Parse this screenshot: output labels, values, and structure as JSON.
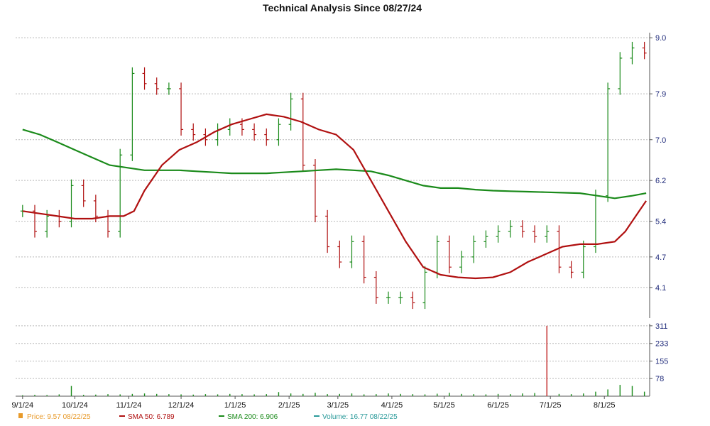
{
  "chart_data": {
    "type": "line",
    "title": "Technical Analysis Since 08/27/24",
    "price_panel": {
      "ylim": [
        3.5,
        9.1
      ],
      "y_ticks": [
        "9.0",
        "7.9",
        "7.0",
        "6.2",
        "5.4",
        "4.7",
        "4.1"
      ],
      "y_tick_values": [
        9.0,
        7.9,
        7.0,
        6.2,
        5.4,
        4.7,
        4.1
      ],
      "grid": true
    },
    "volume_panel": {
      "ylim": [
        0,
        320
      ],
      "y_ticks": [
        "311",
        "233",
        "155",
        "78"
      ],
      "y_tick_values": [
        311,
        233,
        155,
        78
      ],
      "grid": true
    },
    "x_ticks": [
      "9/1/24",
      "10/1/24",
      "11/1/24",
      "12/1/24",
      "1/1/25",
      "2/1/25",
      "3/1/25",
      "4/1/25",
      "5/1/25",
      "6/1/25",
      "7/1/25",
      "8/1/25"
    ],
    "x_tick_days": [
      0,
      30,
      61,
      91,
      122,
      153,
      181,
      212,
      242,
      273,
      303,
      334
    ],
    "x_range_days": [
      -4,
      360
    ],
    "price": {
      "name": "Price",
      "color": "#1a8a1a",
      "down_color": "#b01010",
      "x_days": [
        0,
        7,
        14,
        21,
        28,
        35,
        42,
        49,
        56,
        63,
        70,
        77,
        84,
        91,
        98,
        105,
        112,
        119,
        126,
        133,
        140,
        147,
        154,
        161,
        168,
        175,
        182,
        189,
        196,
        203,
        210,
        217,
        224,
        231,
        238,
        245,
        252,
        259,
        266,
        273,
        280,
        287,
        294,
        301,
        308,
        315,
        322,
        329,
        336,
        343,
        350,
        357
      ],
      "close": [
        5.6,
        5.2,
        5.5,
        5.4,
        6.1,
        5.8,
        5.5,
        5.2,
        6.7,
        8.3,
        8.1,
        8.0,
        8.0,
        7.2,
        7.1,
        7.0,
        7.2,
        7.3,
        7.2,
        7.1,
        7.0,
        7.3,
        7.8,
        6.5,
        5.5,
        4.9,
        4.6,
        5.0,
        4.3,
        3.9,
        3.9,
        3.9,
        3.8,
        4.4,
        5.0,
        4.5,
        4.7,
        5.0,
        5.1,
        5.2,
        5.3,
        5.2,
        5.1,
        5.2,
        4.5,
        4.4,
        4.9,
        5.9,
        8.0,
        8.6,
        8.8,
        8.7
      ]
    },
    "sma50": {
      "name": "SMA 50",
      "color": "#b01010",
      "x_days": [
        0,
        10,
        20,
        30,
        40,
        50,
        58,
        64,
        70,
        80,
        90,
        100,
        110,
        120,
        130,
        140,
        150,
        160,
        170,
        180,
        190,
        200,
        210,
        220,
        230,
        240,
        250,
        260,
        270,
        280,
        290,
        300,
        310,
        320,
        330,
        340,
        346,
        352,
        358
      ],
      "values": [
        5.6,
        5.55,
        5.5,
        5.45,
        5.45,
        5.5,
        5.5,
        5.6,
        6.0,
        6.5,
        6.8,
        6.95,
        7.15,
        7.3,
        7.4,
        7.5,
        7.45,
        7.35,
        7.2,
        7.1,
        6.8,
        6.2,
        5.6,
        5.0,
        4.5,
        4.35,
        4.3,
        4.28,
        4.3,
        4.4,
        4.6,
        4.75,
        4.9,
        4.95,
        4.95,
        5.0,
        5.2,
        5.5,
        5.8
      ]
    },
    "sma200": {
      "name": "SMA 200",
      "color": "#1a8a1a",
      "x_days": [
        0,
        10,
        20,
        30,
        40,
        50,
        60,
        70,
        80,
        90,
        100,
        110,
        120,
        130,
        140,
        150,
        160,
        170,
        180,
        190,
        200,
        210,
        220,
        230,
        240,
        250,
        260,
        270,
        280,
        290,
        300,
        310,
        320,
        330,
        340,
        350,
        358
      ],
      "values": [
        7.2,
        7.1,
        6.95,
        6.8,
        6.65,
        6.5,
        6.45,
        6.4,
        6.4,
        6.4,
        6.38,
        6.36,
        6.34,
        6.34,
        6.34,
        6.36,
        6.38,
        6.4,
        6.42,
        6.4,
        6.38,
        6.3,
        6.2,
        6.1,
        6.05,
        6.05,
        6.02,
        6.0,
        5.99,
        5.98,
        5.97,
        5.96,
        5.95,
        5.9,
        5.85,
        5.9,
        5.95
      ]
    },
    "volume": {
      "name": "Volume",
      "color": "#1a8a1a",
      "x_days": [
        0,
        7,
        14,
        21,
        28,
        35,
        42,
        49,
        56,
        63,
        70,
        77,
        84,
        91,
        98,
        105,
        112,
        119,
        126,
        133,
        140,
        147,
        154,
        161,
        168,
        175,
        182,
        189,
        196,
        203,
        210,
        217,
        224,
        231,
        238,
        245,
        252,
        259,
        266,
        273,
        280,
        287,
        294,
        301,
        308,
        315,
        322,
        329,
        336,
        343,
        350,
        357
      ],
      "values": [
        4,
        6,
        5,
        8,
        45,
        6,
        7,
        9,
        8,
        10,
        12,
        10,
        9,
        8,
        7,
        9,
        8,
        10,
        9,
        8,
        9,
        18,
        12,
        10,
        15,
        9,
        10,
        12,
        8,
        9,
        12,
        10,
        9,
        8,
        11,
        15,
        10,
        9,
        8,
        10,
        9,
        12,
        14,
        311,
        10,
        9,
        12,
        20,
        30,
        50,
        45,
        20
      ]
    },
    "legend": [
      {
        "label": "Price: 9.57  08/22/25",
        "color": "#e89a2a"
      },
      {
        "label": "SMA 50: 6.789",
        "color": "#b01010"
      },
      {
        "label": "SMA 200: 6.906",
        "color": "#1a8a1a"
      },
      {
        "label": "Volume: 16.77  08/22/25",
        "color": "#2a9a9a"
      }
    ]
  }
}
